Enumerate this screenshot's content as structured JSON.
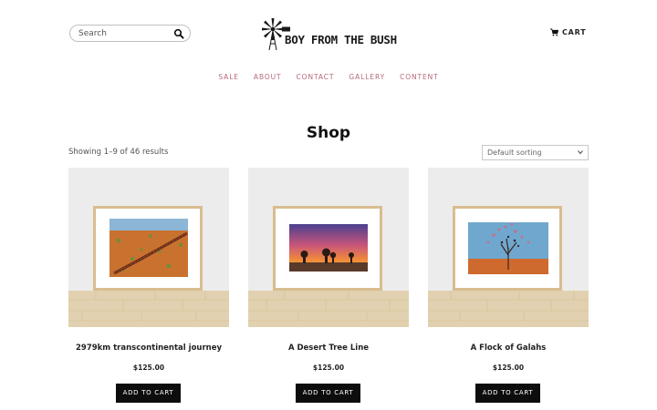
{
  "header": {
    "search_placeholder": "Search",
    "logo_text": "BOY FROM THE BUSH",
    "cart_label": "CART"
  },
  "nav": {
    "items": [
      {
        "label": "SALE"
      },
      {
        "label": "ABOUT"
      },
      {
        "label": "CONTACT"
      },
      {
        "label": "GALLERY"
      },
      {
        "label": "CONTENT"
      }
    ],
    "color": "#b56a78"
  },
  "shop": {
    "title": "Shop",
    "result_count": "Showing 1–9 of 46 results",
    "sort_selected": "Default sorting"
  },
  "products": [
    {
      "name": "2979km transcontinental journey",
      "price": "$125.00",
      "button": "ADD TO CART"
    },
    {
      "name": "A Desert Tree Line",
      "price": "$125.00",
      "button": "ADD TO CART"
    },
    {
      "name": "A Flock of Galahs",
      "price": "$125.00",
      "button": "ADD TO CART"
    }
  ],
  "icons": {
    "search": "search-icon",
    "cart": "cart-icon",
    "logo": "windmill-icon",
    "sort_caret": "chevron-down-icon"
  }
}
